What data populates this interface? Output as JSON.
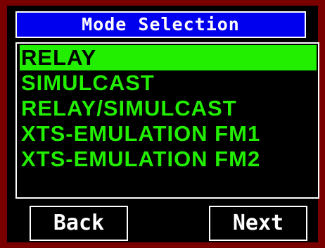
{
  "window": {
    "title": "Mode Selection"
  },
  "mode_list": {
    "items": [
      {
        "label": "RELAY",
        "selected": true
      },
      {
        "label": "SIMULCAST",
        "selected": false
      },
      {
        "label": "RELAY/SIMULCAST",
        "selected": false
      },
      {
        "label": "XTS-EMULATION FM1",
        "selected": false
      },
      {
        "label": "XTS-EMULATION FM2",
        "selected": false
      }
    ]
  },
  "buttons": {
    "back_label": "Back",
    "next_label": "Next"
  },
  "colors": {
    "frame": "#7a0000",
    "title_bg": "#0000ee",
    "list_text": "#22ee00",
    "selection_bg": "#22ee00"
  }
}
